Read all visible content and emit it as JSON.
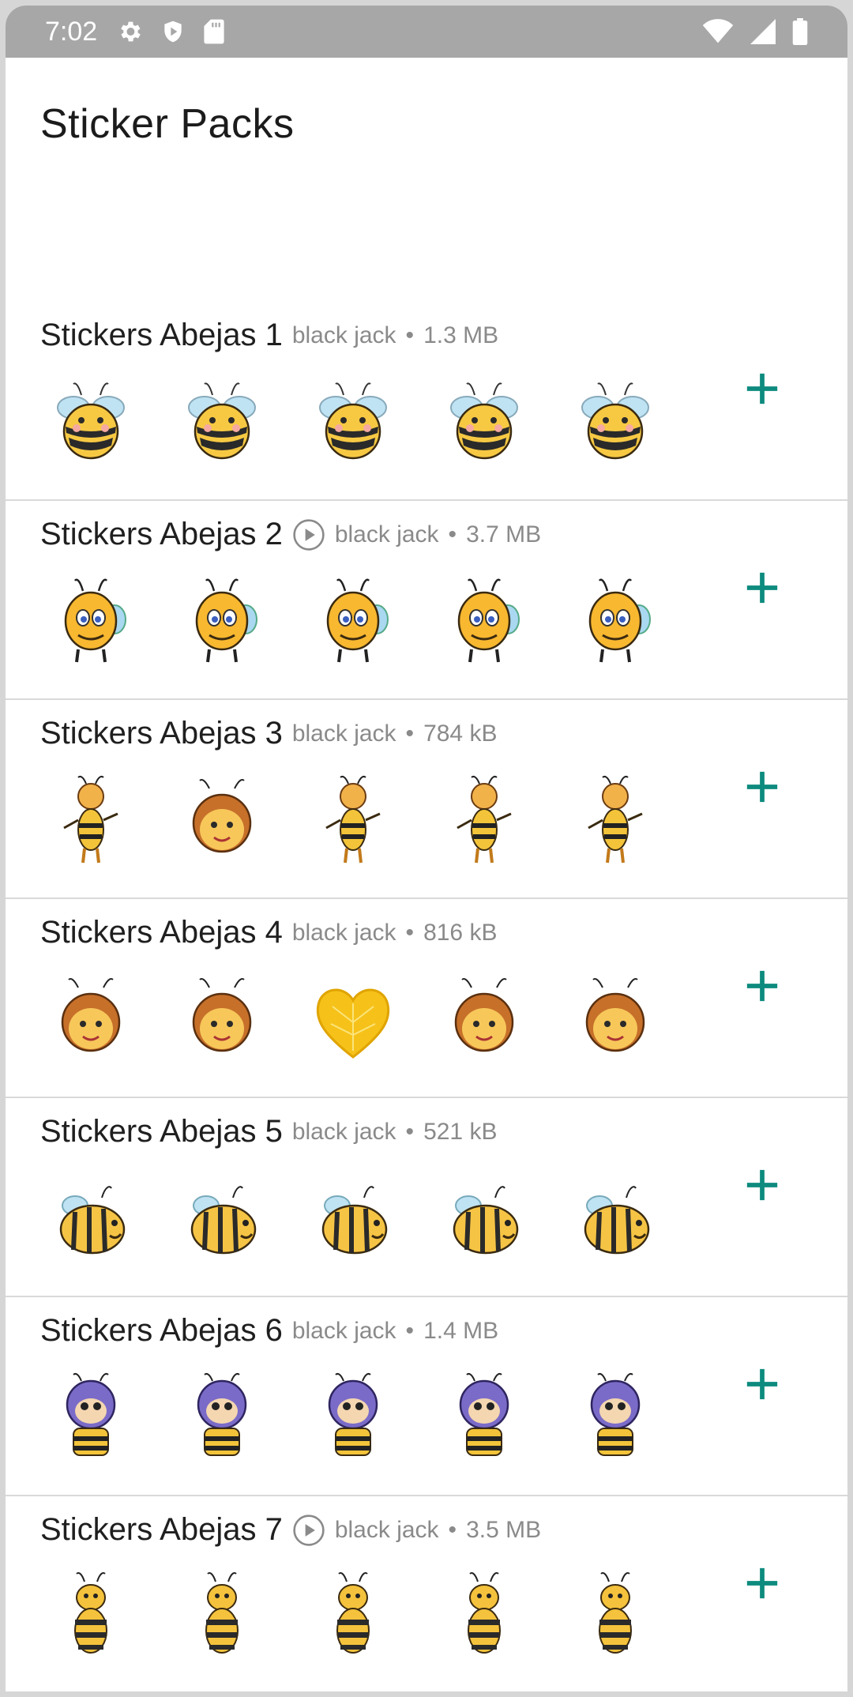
{
  "status_bar": {
    "time": "7:02",
    "left_icons": [
      "gear-icon",
      "shield-play-icon",
      "sd-card-icon"
    ],
    "right_icons": [
      "wifi-icon",
      "signal-icon",
      "battery-icon"
    ]
  },
  "app": {
    "title": "Sticker Packs"
  },
  "accent_color": "#0d8b7e",
  "packs": [
    {
      "name": "Stickers Abejas 1",
      "publisher": "black jack",
      "size": "1.3 MB",
      "animated": false,
      "add_icon": "plus-icon"
    },
    {
      "name": "Stickers Abejas 2",
      "publisher": "black jack",
      "size": "3.7 MB",
      "animated": true,
      "add_icon": "plus-icon"
    },
    {
      "name": "Stickers Abejas 3",
      "publisher": "black jack",
      "size": "784 kB",
      "animated": false,
      "add_icon": "plus-icon"
    },
    {
      "name": "Stickers Abejas 4",
      "publisher": "black jack",
      "size": "816 kB",
      "animated": false,
      "add_icon": "plus-icon"
    },
    {
      "name": "Stickers Abejas 5",
      "publisher": "black jack",
      "size": "521 kB",
      "animated": false,
      "add_icon": "plus-icon"
    },
    {
      "name": "Stickers Abejas 6",
      "publisher": "black jack",
      "size": "1.4 MB",
      "animated": false,
      "add_icon": "plus-icon"
    },
    {
      "name": "Stickers Abejas 7",
      "publisher": "black jack",
      "size": "3.5 MB",
      "animated": true,
      "add_icon": "plus-icon"
    }
  ]
}
